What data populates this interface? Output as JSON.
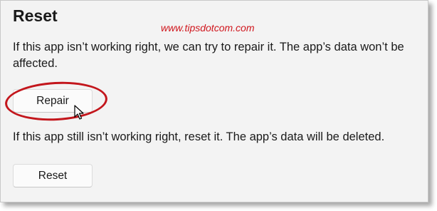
{
  "section": {
    "title": "Reset",
    "watermark": "www.tipsdotcom.com"
  },
  "repair": {
    "description": "If this app isn’t working right, we can try to repair it. The app’s data won’t be affected.",
    "button_label": "Repair"
  },
  "reset": {
    "description": "If this app still isn’t working right, reset it. The app’s data will be deleted.",
    "button_label": "Reset"
  },
  "annotation": {
    "highlight_color": "#c3161c",
    "cursor_icon": "mouse-pointer-icon"
  }
}
